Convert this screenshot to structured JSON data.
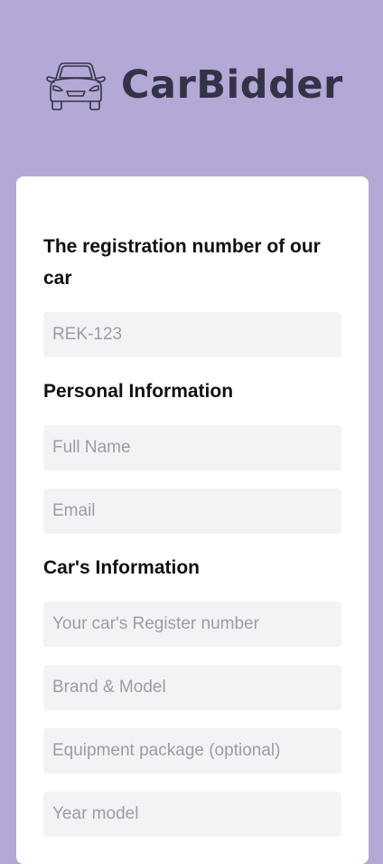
{
  "brand": {
    "name": "CarBidder",
    "text_color": "#343247",
    "icon": "car-front-icon"
  },
  "colors": {
    "background": "#b3a8d6",
    "card": "#ffffff",
    "input_background": "#f3f3f5",
    "placeholder": "#9b9ca6"
  },
  "form": {
    "registration": {
      "title": "The registration number of our car",
      "placeholder": "REK-123"
    },
    "personal": {
      "title": "Personal Information",
      "full_name_placeholder": "Full Name",
      "email_placeholder": "Email"
    },
    "car": {
      "title": "Car's Information",
      "register_number_placeholder": "Your car's Register number",
      "brand_model_placeholder": "Brand & Model",
      "equipment_placeholder": "Equipment package (optional)",
      "year_model_placeholder": "Year model"
    }
  }
}
